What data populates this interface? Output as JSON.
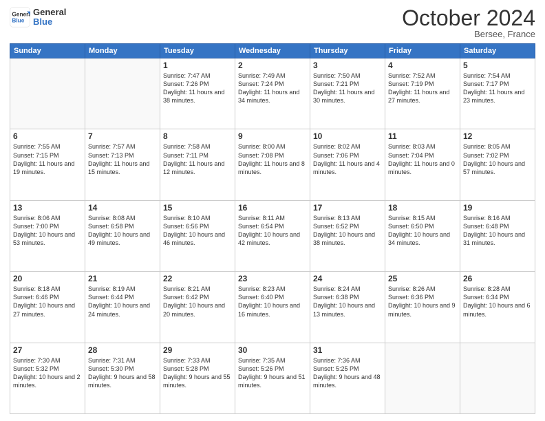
{
  "header": {
    "logo_line1": "General",
    "logo_line2": "Blue",
    "month": "October 2024",
    "location": "Bersee, France"
  },
  "weekdays": [
    "Sunday",
    "Monday",
    "Tuesday",
    "Wednesday",
    "Thursday",
    "Friday",
    "Saturday"
  ],
  "weeks": [
    [
      {
        "day": "",
        "sunrise": "",
        "sunset": "",
        "daylight": ""
      },
      {
        "day": "",
        "sunrise": "",
        "sunset": "",
        "daylight": ""
      },
      {
        "day": "1",
        "sunrise": "Sunrise: 7:47 AM",
        "sunset": "Sunset: 7:26 PM",
        "daylight": "Daylight: 11 hours and 38 minutes."
      },
      {
        "day": "2",
        "sunrise": "Sunrise: 7:49 AM",
        "sunset": "Sunset: 7:24 PM",
        "daylight": "Daylight: 11 hours and 34 minutes."
      },
      {
        "day": "3",
        "sunrise": "Sunrise: 7:50 AM",
        "sunset": "Sunset: 7:21 PM",
        "daylight": "Daylight: 11 hours and 30 minutes."
      },
      {
        "day": "4",
        "sunrise": "Sunrise: 7:52 AM",
        "sunset": "Sunset: 7:19 PM",
        "daylight": "Daylight: 11 hours and 27 minutes."
      },
      {
        "day": "5",
        "sunrise": "Sunrise: 7:54 AM",
        "sunset": "Sunset: 7:17 PM",
        "daylight": "Daylight: 11 hours and 23 minutes."
      }
    ],
    [
      {
        "day": "6",
        "sunrise": "Sunrise: 7:55 AM",
        "sunset": "Sunset: 7:15 PM",
        "daylight": "Daylight: 11 hours and 19 minutes."
      },
      {
        "day": "7",
        "sunrise": "Sunrise: 7:57 AM",
        "sunset": "Sunset: 7:13 PM",
        "daylight": "Daylight: 11 hours and 15 minutes."
      },
      {
        "day": "8",
        "sunrise": "Sunrise: 7:58 AM",
        "sunset": "Sunset: 7:11 PM",
        "daylight": "Daylight: 11 hours and 12 minutes."
      },
      {
        "day": "9",
        "sunrise": "Sunrise: 8:00 AM",
        "sunset": "Sunset: 7:08 PM",
        "daylight": "Daylight: 11 hours and 8 minutes."
      },
      {
        "day": "10",
        "sunrise": "Sunrise: 8:02 AM",
        "sunset": "Sunset: 7:06 PM",
        "daylight": "Daylight: 11 hours and 4 minutes."
      },
      {
        "day": "11",
        "sunrise": "Sunrise: 8:03 AM",
        "sunset": "Sunset: 7:04 PM",
        "daylight": "Daylight: 11 hours and 0 minutes."
      },
      {
        "day": "12",
        "sunrise": "Sunrise: 8:05 AM",
        "sunset": "Sunset: 7:02 PM",
        "daylight": "Daylight: 10 hours and 57 minutes."
      }
    ],
    [
      {
        "day": "13",
        "sunrise": "Sunrise: 8:06 AM",
        "sunset": "Sunset: 7:00 PM",
        "daylight": "Daylight: 10 hours and 53 minutes."
      },
      {
        "day": "14",
        "sunrise": "Sunrise: 8:08 AM",
        "sunset": "Sunset: 6:58 PM",
        "daylight": "Daylight: 10 hours and 49 minutes."
      },
      {
        "day": "15",
        "sunrise": "Sunrise: 8:10 AM",
        "sunset": "Sunset: 6:56 PM",
        "daylight": "Daylight: 10 hours and 46 minutes."
      },
      {
        "day": "16",
        "sunrise": "Sunrise: 8:11 AM",
        "sunset": "Sunset: 6:54 PM",
        "daylight": "Daylight: 10 hours and 42 minutes."
      },
      {
        "day": "17",
        "sunrise": "Sunrise: 8:13 AM",
        "sunset": "Sunset: 6:52 PM",
        "daylight": "Daylight: 10 hours and 38 minutes."
      },
      {
        "day": "18",
        "sunrise": "Sunrise: 8:15 AM",
        "sunset": "Sunset: 6:50 PM",
        "daylight": "Daylight: 10 hours and 34 minutes."
      },
      {
        "day": "19",
        "sunrise": "Sunrise: 8:16 AM",
        "sunset": "Sunset: 6:48 PM",
        "daylight": "Daylight: 10 hours and 31 minutes."
      }
    ],
    [
      {
        "day": "20",
        "sunrise": "Sunrise: 8:18 AM",
        "sunset": "Sunset: 6:46 PM",
        "daylight": "Daylight: 10 hours and 27 minutes."
      },
      {
        "day": "21",
        "sunrise": "Sunrise: 8:19 AM",
        "sunset": "Sunset: 6:44 PM",
        "daylight": "Daylight: 10 hours and 24 minutes."
      },
      {
        "day": "22",
        "sunrise": "Sunrise: 8:21 AM",
        "sunset": "Sunset: 6:42 PM",
        "daylight": "Daylight: 10 hours and 20 minutes."
      },
      {
        "day": "23",
        "sunrise": "Sunrise: 8:23 AM",
        "sunset": "Sunset: 6:40 PM",
        "daylight": "Daylight: 10 hours and 16 minutes."
      },
      {
        "day": "24",
        "sunrise": "Sunrise: 8:24 AM",
        "sunset": "Sunset: 6:38 PM",
        "daylight": "Daylight: 10 hours and 13 minutes."
      },
      {
        "day": "25",
        "sunrise": "Sunrise: 8:26 AM",
        "sunset": "Sunset: 6:36 PM",
        "daylight": "Daylight: 10 hours and 9 minutes."
      },
      {
        "day": "26",
        "sunrise": "Sunrise: 8:28 AM",
        "sunset": "Sunset: 6:34 PM",
        "daylight": "Daylight: 10 hours and 6 minutes."
      }
    ],
    [
      {
        "day": "27",
        "sunrise": "Sunrise: 7:30 AM",
        "sunset": "Sunset: 5:32 PM",
        "daylight": "Daylight: 10 hours and 2 minutes."
      },
      {
        "day": "28",
        "sunrise": "Sunrise: 7:31 AM",
        "sunset": "Sunset: 5:30 PM",
        "daylight": "Daylight: 9 hours and 58 minutes."
      },
      {
        "day": "29",
        "sunrise": "Sunrise: 7:33 AM",
        "sunset": "Sunset: 5:28 PM",
        "daylight": "Daylight: 9 hours and 55 minutes."
      },
      {
        "day": "30",
        "sunrise": "Sunrise: 7:35 AM",
        "sunset": "Sunset: 5:26 PM",
        "daylight": "Daylight: 9 hours and 51 minutes."
      },
      {
        "day": "31",
        "sunrise": "Sunrise: 7:36 AM",
        "sunset": "Sunset: 5:25 PM",
        "daylight": "Daylight: 9 hours and 48 minutes."
      },
      {
        "day": "",
        "sunrise": "",
        "sunset": "",
        "daylight": ""
      },
      {
        "day": "",
        "sunrise": "",
        "sunset": "",
        "daylight": ""
      }
    ]
  ]
}
